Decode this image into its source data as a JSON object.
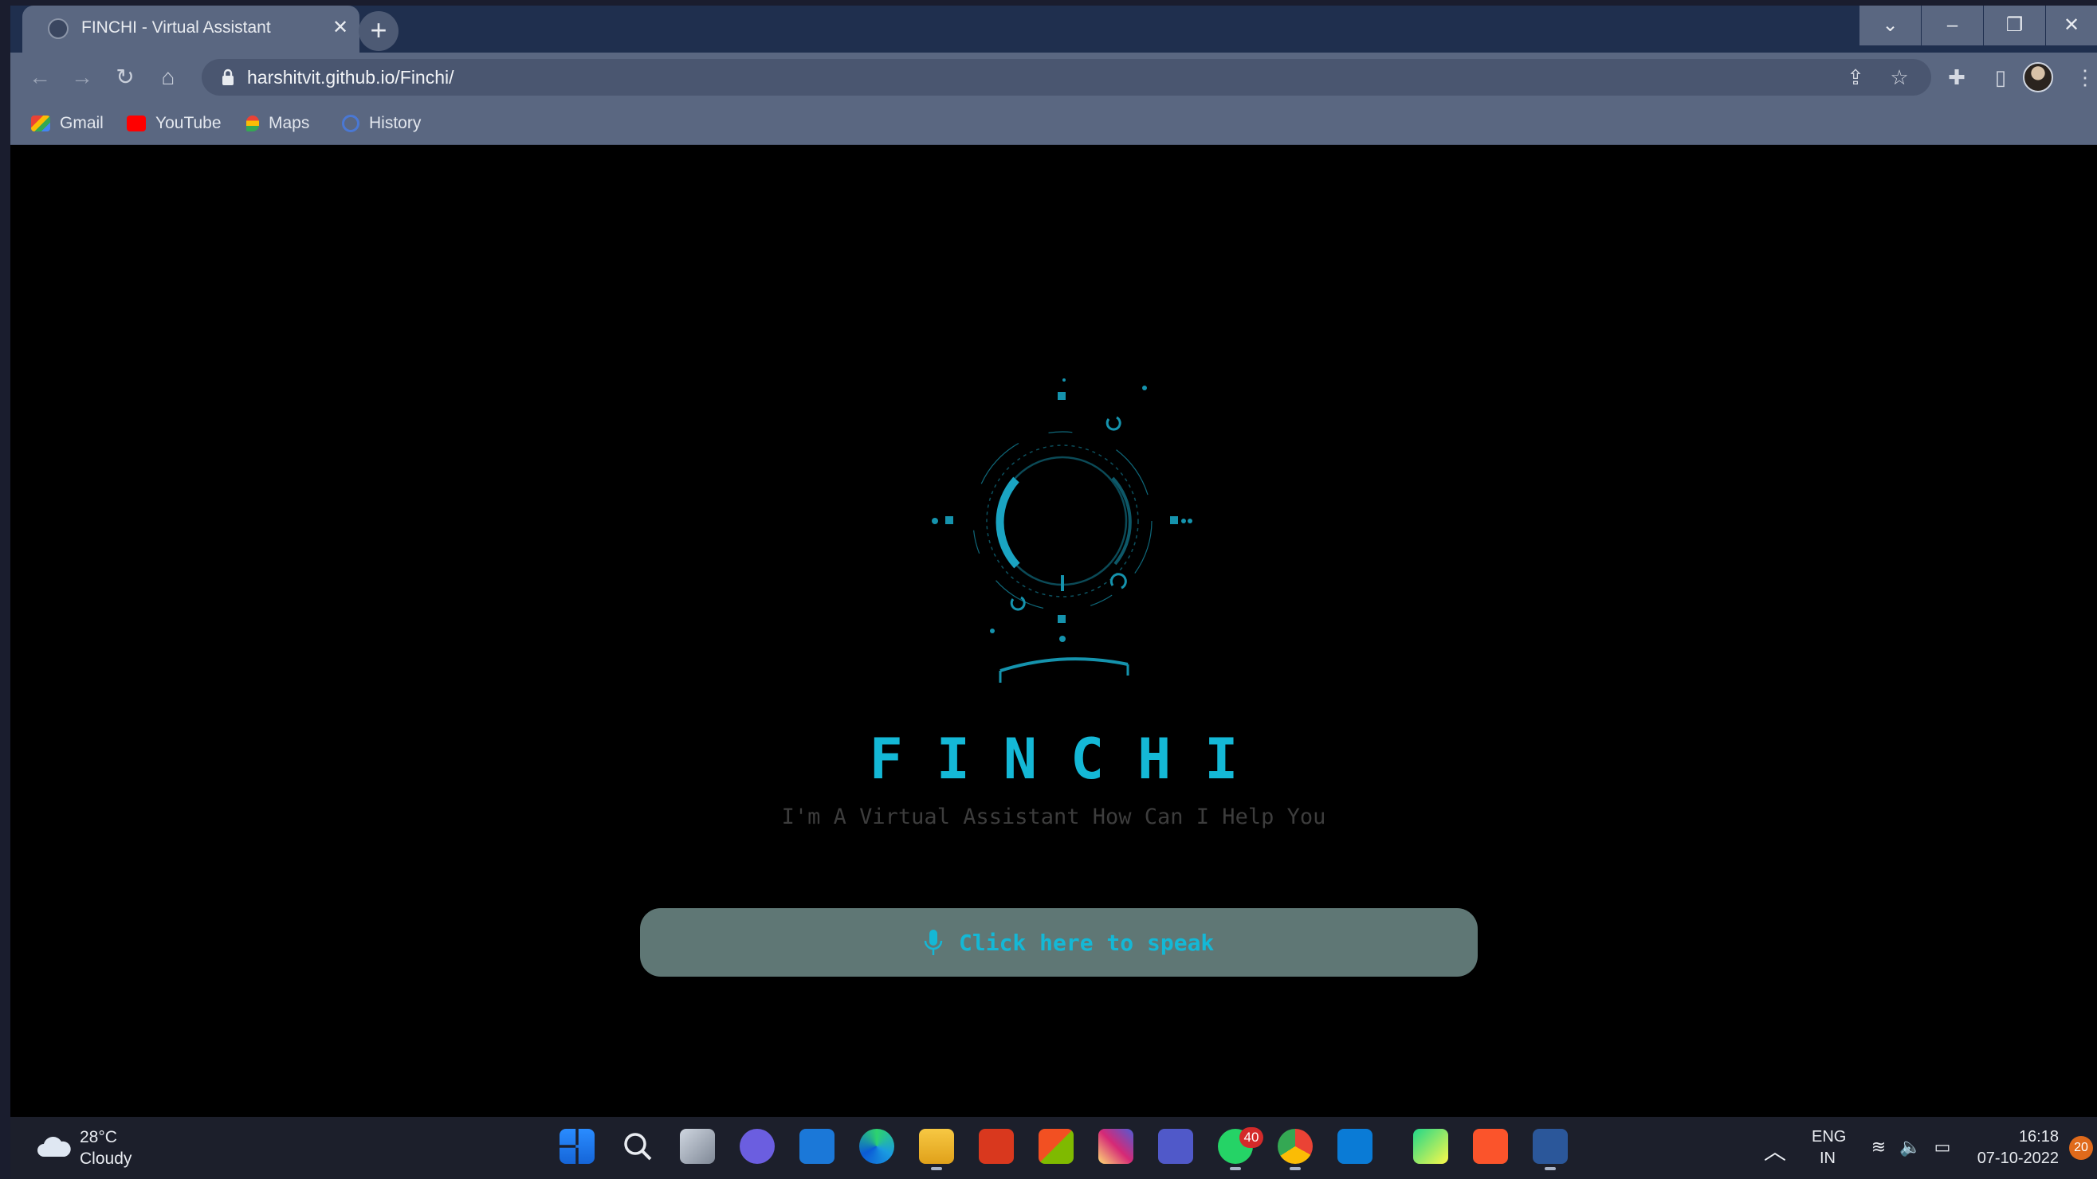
{
  "browser": {
    "tab_title": "FINCHI - Virtual Assistant",
    "tab_close": "✕",
    "new_tab": "+",
    "url": "harshitvit.github.io/Finchi/",
    "window_buttons": {
      "dropdown": "⌄",
      "minimize": "–",
      "restore": "❐",
      "close": "✕"
    }
  },
  "bookmarks": [
    {
      "label": "Gmail",
      "icon": "gmail-icon"
    },
    {
      "label": "YouTube",
      "icon": "youtube-icon"
    },
    {
      "label": "Maps",
      "icon": "maps-icon"
    },
    {
      "label": "History",
      "icon": "history-icon"
    }
  ],
  "page": {
    "brand": "FINCHI",
    "tagline": "I'm A Virtual Assistant How Can I Help You",
    "speak_button": "Click here to speak",
    "accent_color": "#14b8d6"
  },
  "taskbar": {
    "weather_temp": "28°C",
    "weather_condition": "Cloudy",
    "whatsapp_badge": "40",
    "lang_line1": "ENG",
    "lang_line2": "IN",
    "time": "16:18",
    "date": "07-10-2022",
    "notifications": "20"
  }
}
